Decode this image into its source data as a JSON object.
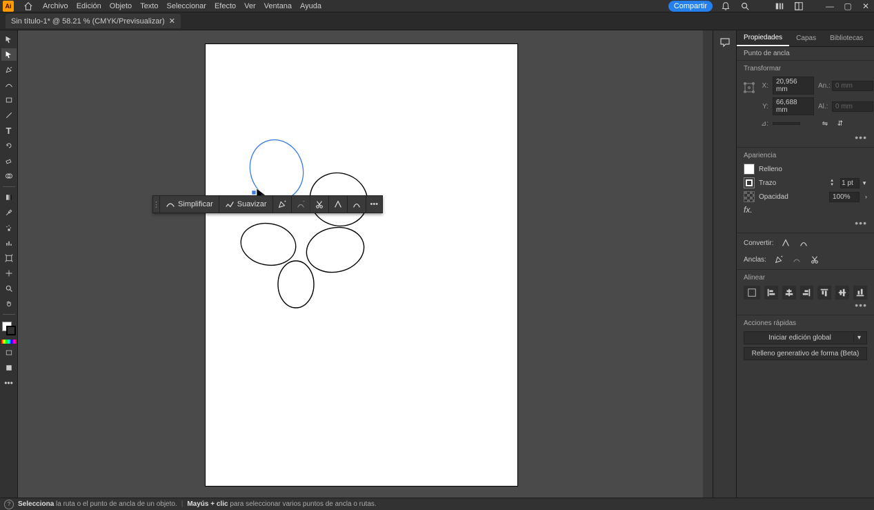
{
  "menubar": {
    "items": [
      "Archivo",
      "Edición",
      "Objeto",
      "Texto",
      "Seleccionar",
      "Efecto",
      "Ver",
      "Ventana",
      "Ayuda"
    ],
    "share": "Compartir"
  },
  "tab": {
    "title": "Sin título-1* @ 58.21 % (CMYK/Previsualizar)"
  },
  "ctx_toolbar": {
    "simplify": "Simplificar",
    "smooth": "Suavizar"
  },
  "props": {
    "tabs": [
      "Propiedades",
      "Capas",
      "Bibliotecas"
    ],
    "subtitle": "Punto de ancla",
    "transform": {
      "title": "Transformar",
      "x_label": "X:",
      "x": "20,956 mm",
      "w_label": "An.:",
      "w": "0 mm",
      "y_label": "Y:",
      "y": "66,688 mm",
      "h_label": "Al.:",
      "h": "0 mm",
      "angle_label": "⊿:"
    },
    "appearance": {
      "title": "Apariencia",
      "fill": "Relleno",
      "stroke": "Trazo",
      "stroke_val": "1 pt",
      "opacity_label": "Opacidad",
      "opacity": "100%",
      "fx": "fx."
    },
    "convert": {
      "label": "Convertir:"
    },
    "anchors": {
      "label": "Anclas:"
    },
    "align": {
      "title": "Alinear"
    },
    "quick": {
      "title": "Acciones rápidas",
      "global_edit": "Iniciar edición global",
      "gen_fill": "Relleno generativo de forma (Beta)"
    }
  },
  "status": {
    "bold1": "Selecciona",
    "text1": " la ruta o el punto de ancla de un objeto.",
    "bold2": "Mayús + clic",
    "text2": " para seleccionar varios puntos de ancla o rutas."
  }
}
